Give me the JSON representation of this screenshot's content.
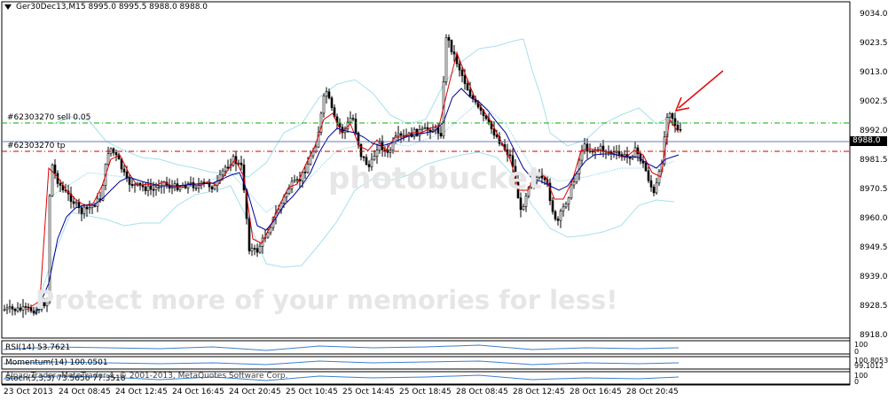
{
  "chart": {
    "header": "Ger30Dec13,M15  8995.0 8995.5 8988.0 8988.0",
    "order_sell_label": "#62303270 sell 0.05",
    "order_tp_label": "#62303270 tp",
    "current_price": "8988.0"
  },
  "price_axis": [
    "9034.0",
    "9023.5",
    "9013.0",
    "9002.5",
    "8992.0",
    "8981.5",
    "8970.5",
    "8960.0",
    "8949.5",
    "8939.0",
    "8928.5",
    "8918.0"
  ],
  "time_axis": [
    "23 Oct 2013",
    "24 Oct 08:45",
    "24 Oct 12:45",
    "24 Oct 16:45",
    "24 Oct 20:45",
    "25 Oct 10:45",
    "25 Oct 14:45",
    "25 Oct 18:45",
    "28 Oct 08:45",
    "28 Oct 12:45",
    "28 Oct 16:45",
    "28 Oct 20:45"
  ],
  "indicators": {
    "rsi": {
      "label": "RSI(14) 53.7621",
      "axis_top": "100",
      "axis_bottom": "0"
    },
    "momentum": {
      "label": "Momentum(14) 100.0501",
      "axis_top": "100.8053",
      "axis_bottom": "99.1012"
    },
    "stoch": {
      "label": "Stoch(5,3,3) 73.5656 77.3518",
      "axis_top": "100",
      "axis_bottom": "0"
    }
  },
  "watermarks": {
    "photobucket": "photobucket",
    "protect": "Protect more of your memories for less!"
  },
  "footer": "Alpari Trader, MetaTrader 4, © 2001-2013, MetaQuotes Software Corp.",
  "colors": {
    "background": "#ffffff",
    "candle": "#000000",
    "bollinger": "#a6e0ec",
    "ma_fast": "#e00000",
    "ma_slow": "#000099",
    "order_sell_line": "#00b000",
    "order_tp_line": "#cc0000",
    "current_price_line": "#6c7ab0",
    "arrow": "#e01010",
    "indicator_line": "#3a7fd0"
  }
}
